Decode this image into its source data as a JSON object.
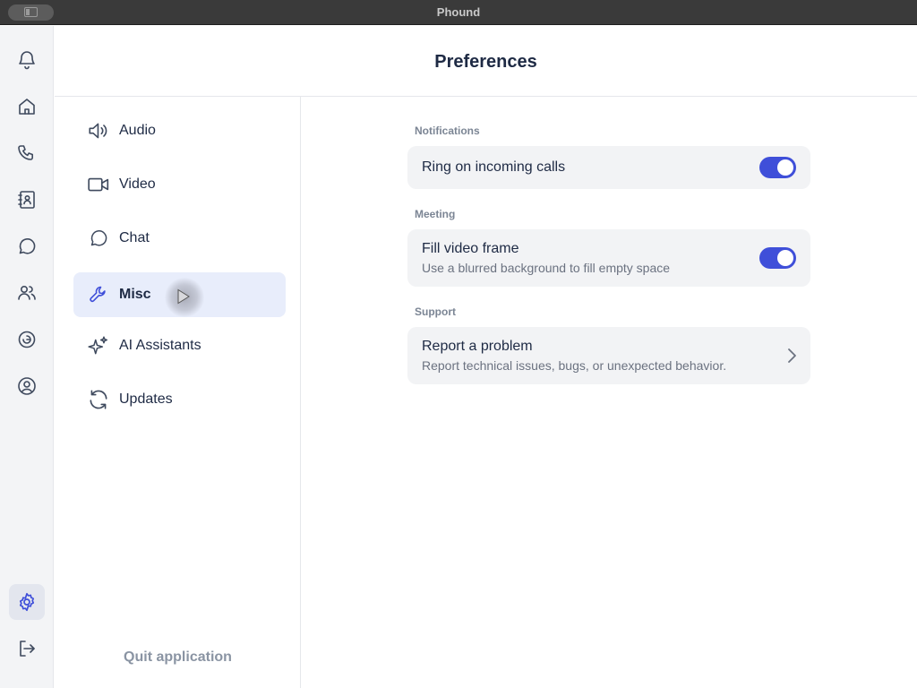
{
  "window": {
    "title": "Phound"
  },
  "header": {
    "title": "Preferences"
  },
  "rail": {
    "items": [
      {
        "name": "notifications",
        "icon": "bell-icon"
      },
      {
        "name": "home",
        "icon": "home-icon"
      },
      {
        "name": "calls",
        "icon": "phone-icon"
      },
      {
        "name": "contacts",
        "icon": "contacts-book-icon"
      },
      {
        "name": "chat",
        "icon": "chat-bubble-icon"
      },
      {
        "name": "people",
        "icon": "users-icon"
      },
      {
        "name": "ai",
        "icon": "swirl-icon"
      },
      {
        "name": "profile",
        "icon": "user-circle-icon"
      },
      {
        "name": "settings",
        "icon": "gear-icon",
        "active": true
      },
      {
        "name": "logout",
        "icon": "logout-icon"
      }
    ]
  },
  "subnav": {
    "items": [
      {
        "label": "Audio",
        "icon": "speaker-icon"
      },
      {
        "label": "Video",
        "icon": "video-camera-icon"
      },
      {
        "label": "Chat",
        "icon": "chat-bubble-icon"
      },
      {
        "label": "Misc",
        "icon": "wrench-icon",
        "active": true
      },
      {
        "label": "AI Assistants",
        "icon": "sparkles-icon"
      },
      {
        "label": "Updates",
        "icon": "refresh-icon"
      }
    ],
    "quit_label": "Quit application"
  },
  "sections": {
    "notifications": {
      "label": "Notifications",
      "ring": {
        "title": "Ring on incoming calls",
        "enabled": true
      }
    },
    "meeting": {
      "label": "Meeting",
      "fill": {
        "title": "Fill video frame",
        "subtitle": "Use a blurred background to fill empty space",
        "enabled": true
      }
    },
    "support": {
      "label": "Support",
      "report": {
        "title": "Report a problem",
        "subtitle": "Report technical issues, bugs, or unexpected behavior."
      }
    }
  },
  "colors": {
    "accent": "#3f4fd9",
    "active_nav_bg": "#e8edfb",
    "icon": "#3f4a5e"
  }
}
